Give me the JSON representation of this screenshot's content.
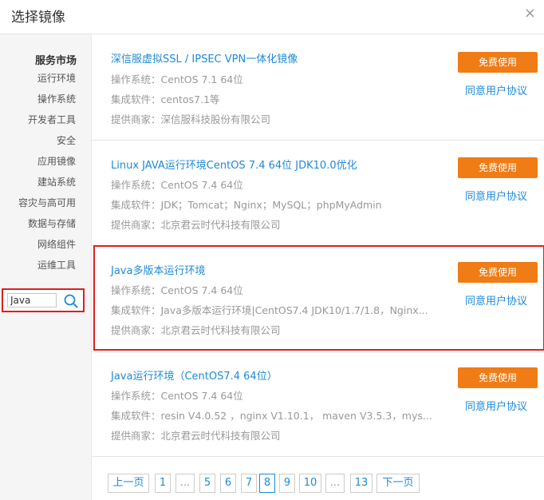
{
  "dialog": {
    "title": "选择镜像",
    "close": "×"
  },
  "sidebar": {
    "section_title": "服务市场",
    "items": [
      {
        "label": "运行环境"
      },
      {
        "label": "操作系统"
      },
      {
        "label": "开发者工具"
      },
      {
        "label": "安全"
      },
      {
        "label": "应用镜像"
      },
      {
        "label": "建站系统"
      },
      {
        "label": "容灾与高可用"
      },
      {
        "label": "数据与存储"
      },
      {
        "label": "网络组件"
      },
      {
        "label": "运维工具"
      }
    ],
    "search": {
      "value": "Java",
      "icon": "search-icon"
    }
  },
  "products": [
    {
      "name": "深信服虚拟SSL / IPSEC VPN一体化镜像",
      "os": "操作系统：CentOS 7.1 64位",
      "software": "集成软件：centos7.1等",
      "vendor": "提供商家：深信服科技股份有限公司",
      "use_label": "免费使用",
      "agree_label": "同意用户协议"
    },
    {
      "name": "Linux JAVA运行环境CentOS 7.4 64位 JDK10.0优化",
      "os": "操作系统：CentOS 7.4 64位",
      "software": "集成软件：JDK；Tomcat；Nginx；MySQL；phpMyAdmin",
      "vendor": "提供商家：北京君云时代科技有限公司",
      "use_label": "免费使用",
      "agree_label": "同意用户协议"
    },
    {
      "name": "Java多版本运行环境",
      "os": "操作系统：CentOS 7.4 64位",
      "software": "集成软件：Java多版本运行环境|CentOS7.4 JDK10/1.7/1.8，Nginx...",
      "vendor": "提供商家：北京君云时代科技有限公司",
      "use_label": "免费使用",
      "agree_label": "同意用户协议"
    },
    {
      "name": "Java运行环境（CentOS7.4 64位）",
      "os": "操作系统：CentOS 7.4 64位",
      "software": "集成软件：resin V4.0.52 ，nginx V1.10.1， maven V3.5.3，mys...",
      "vendor": "提供商家：北京君云时代科技有限公司",
      "use_label": "免费使用",
      "agree_label": "同意用户协议"
    }
  ],
  "pagination": {
    "prev": "上一页",
    "next": "下一页",
    "pages": [
      "1",
      "...",
      "5",
      "6",
      "7",
      "8",
      "9",
      "10",
      "...",
      "13"
    ],
    "current": "8"
  },
  "colors": {
    "accent": "#1e8ad7",
    "button": "#f07c16",
    "highlight": "#e01f1f"
  }
}
